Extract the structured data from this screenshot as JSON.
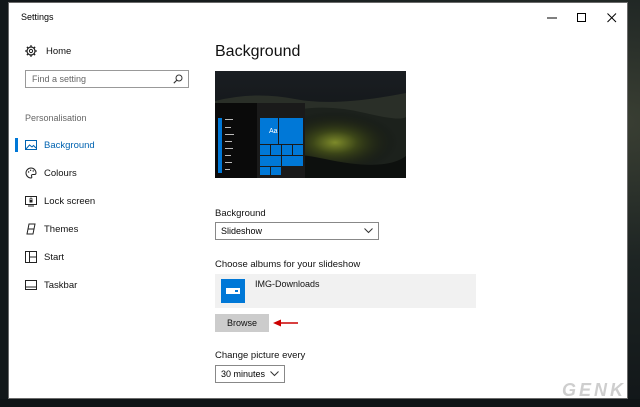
{
  "window": {
    "title": "Settings"
  },
  "sidebar": {
    "home_label": "Home",
    "search_placeholder": "Find a setting",
    "section_label": "Personalisation",
    "items": [
      {
        "label": "Background",
        "icon": "picture-icon",
        "active": true
      },
      {
        "label": "Colours",
        "icon": "palette-icon"
      },
      {
        "label": "Lock screen",
        "icon": "lock-screen-icon"
      },
      {
        "label": "Themes",
        "icon": "themes-icon"
      },
      {
        "label": "Start",
        "icon": "start-icon"
      },
      {
        "label": "Taskbar",
        "icon": "taskbar-icon"
      }
    ]
  },
  "main": {
    "title": "Background",
    "preview_tile_label": "Aa",
    "background_label": "Background",
    "background_value": "Slideshow",
    "albums_label": "Choose albums for your slideshow",
    "album_name": "IMG-Downloads",
    "browse_label": "Browse",
    "interval_label": "Change picture every",
    "interval_value": "30 minutes"
  },
  "watermark": {
    "text": "GENK"
  },
  "colors": {
    "accent": "#0078d7",
    "annotation_arrow": "#cc0000"
  }
}
